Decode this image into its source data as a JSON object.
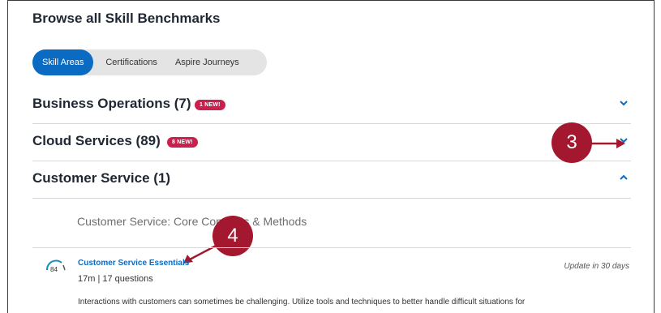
{
  "page": {
    "heading": "Browse all Skill Benchmarks"
  },
  "tabs": [
    {
      "label": "Skill Areas",
      "active": true
    },
    {
      "label": "Certifications",
      "active": false
    },
    {
      "label": "Aspire Journeys",
      "active": false
    }
  ],
  "sections": [
    {
      "title": "Business Operations (7)",
      "badge": "1 NEW!",
      "expanded": false
    },
    {
      "title": "Cloud Services (89)",
      "badge": "8 NEW!",
      "expanded": false
    },
    {
      "title": "Customer Service (1)",
      "badge": "",
      "expanded": true
    }
  ],
  "callouts": {
    "c3": "3",
    "c4": "4"
  },
  "subgroup": {
    "title": "Customer Service: Core Concepts & Methods"
  },
  "course": {
    "score": "84",
    "title": "Customer Service Essentials",
    "meta": "17m  |  17 questions",
    "update": "Update in 30 days",
    "description": "Interactions with customers can sometimes be challenging. Utilize tools and techniques to better handle difficult situations for"
  },
  "colors": {
    "accent": "#0b6bc2",
    "badge": "#cc1f4e",
    "callout": "#a3182f"
  }
}
